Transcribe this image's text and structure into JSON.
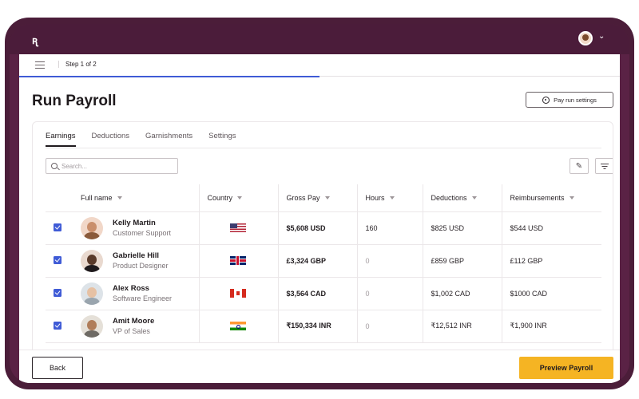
{
  "app": {
    "logo": "ꭆ"
  },
  "stepper": {
    "label": "Step 1 of 2",
    "progress": 0.5
  },
  "page": {
    "title": "Run Payroll",
    "settings_label": "Pay run settings"
  },
  "tabs": [
    "Earnings",
    "Deductions",
    "Garnishments",
    "Settings"
  ],
  "search": {
    "placeholder": "Search..."
  },
  "table": {
    "columns": [
      "Full name",
      "Country",
      "Gross Pay",
      "Hours",
      "Deductions",
      "Reimbursements"
    ],
    "rows": [
      {
        "name": "Kelly Martin",
        "role": "Customer Support",
        "country_flag": "us-flag",
        "gross": "$5,608 USD",
        "hours": "160",
        "deductions": "$825 USD",
        "reimbursements": "$544 USD",
        "checked": true
      },
      {
        "name": "Gabrielle Hill",
        "role": "Product Designer",
        "country_flag": "uk-flag",
        "gross": "£3,324 GBP",
        "hours": "0",
        "deductions": "£859 GBP",
        "reimbursements": "£112 GBP",
        "checked": true
      },
      {
        "name": "Alex Ross",
        "role": "Software Engineer",
        "country_flag": "canada-flag",
        "gross": "$3,564 CAD",
        "hours": "0",
        "deductions": "$1,002 CAD",
        "reimbursements": "$1000 CAD",
        "checked": true
      },
      {
        "name": "Amit Moore",
        "role": "VP of Sales",
        "country_flag": "india-flag",
        "gross": "₹150,334 INR",
        "hours": "0",
        "deductions": "₹12,512 INR",
        "reimbursements": "₹1,900 INR",
        "checked": true
      }
    ]
  },
  "footer": {
    "back_label": "Back",
    "preview_label": "Preview Payroll"
  },
  "colors": {
    "brand": "#4b1c3a",
    "accent": "#3f5bd6",
    "cta": "#f5b423"
  }
}
